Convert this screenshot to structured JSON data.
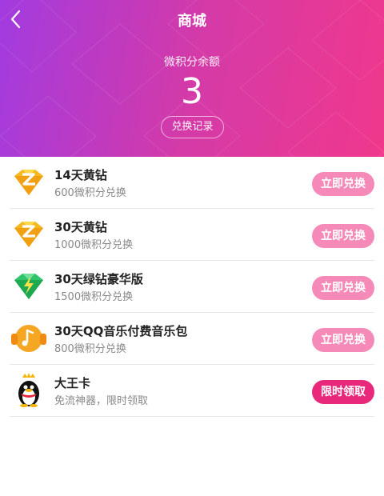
{
  "header": {
    "title": "商城",
    "balance_label": "微积分余额",
    "balance_value": "3",
    "history_button": "兑换记录"
  },
  "colors": {
    "gradient_start": "#a23be0",
    "gradient_end": "#f0388c",
    "button_light": "#f58ab8",
    "button_strong": "#e8287b"
  },
  "items": [
    {
      "name": "14天黄钻",
      "desc": "600微积分兑换",
      "button": "立即兑换",
      "icon": "yellow-diamond-icon"
    },
    {
      "name": "30天黄钻",
      "desc": "1000微积分兑换",
      "button": "立即兑换",
      "icon": "yellow-diamond-icon"
    },
    {
      "name": "30天绿钻豪华版",
      "desc": "1500微积分兑换",
      "button": "立即兑换",
      "icon": "green-diamond-icon"
    },
    {
      "name": "30天QQ音乐付费音乐包",
      "desc": "800微积分兑换",
      "button": "立即兑换",
      "icon": "music-package-icon"
    },
    {
      "name": "大王卡",
      "desc": "免流神器，限时领取",
      "button": "限时领取",
      "icon": "qq-penguin-icon"
    }
  ]
}
